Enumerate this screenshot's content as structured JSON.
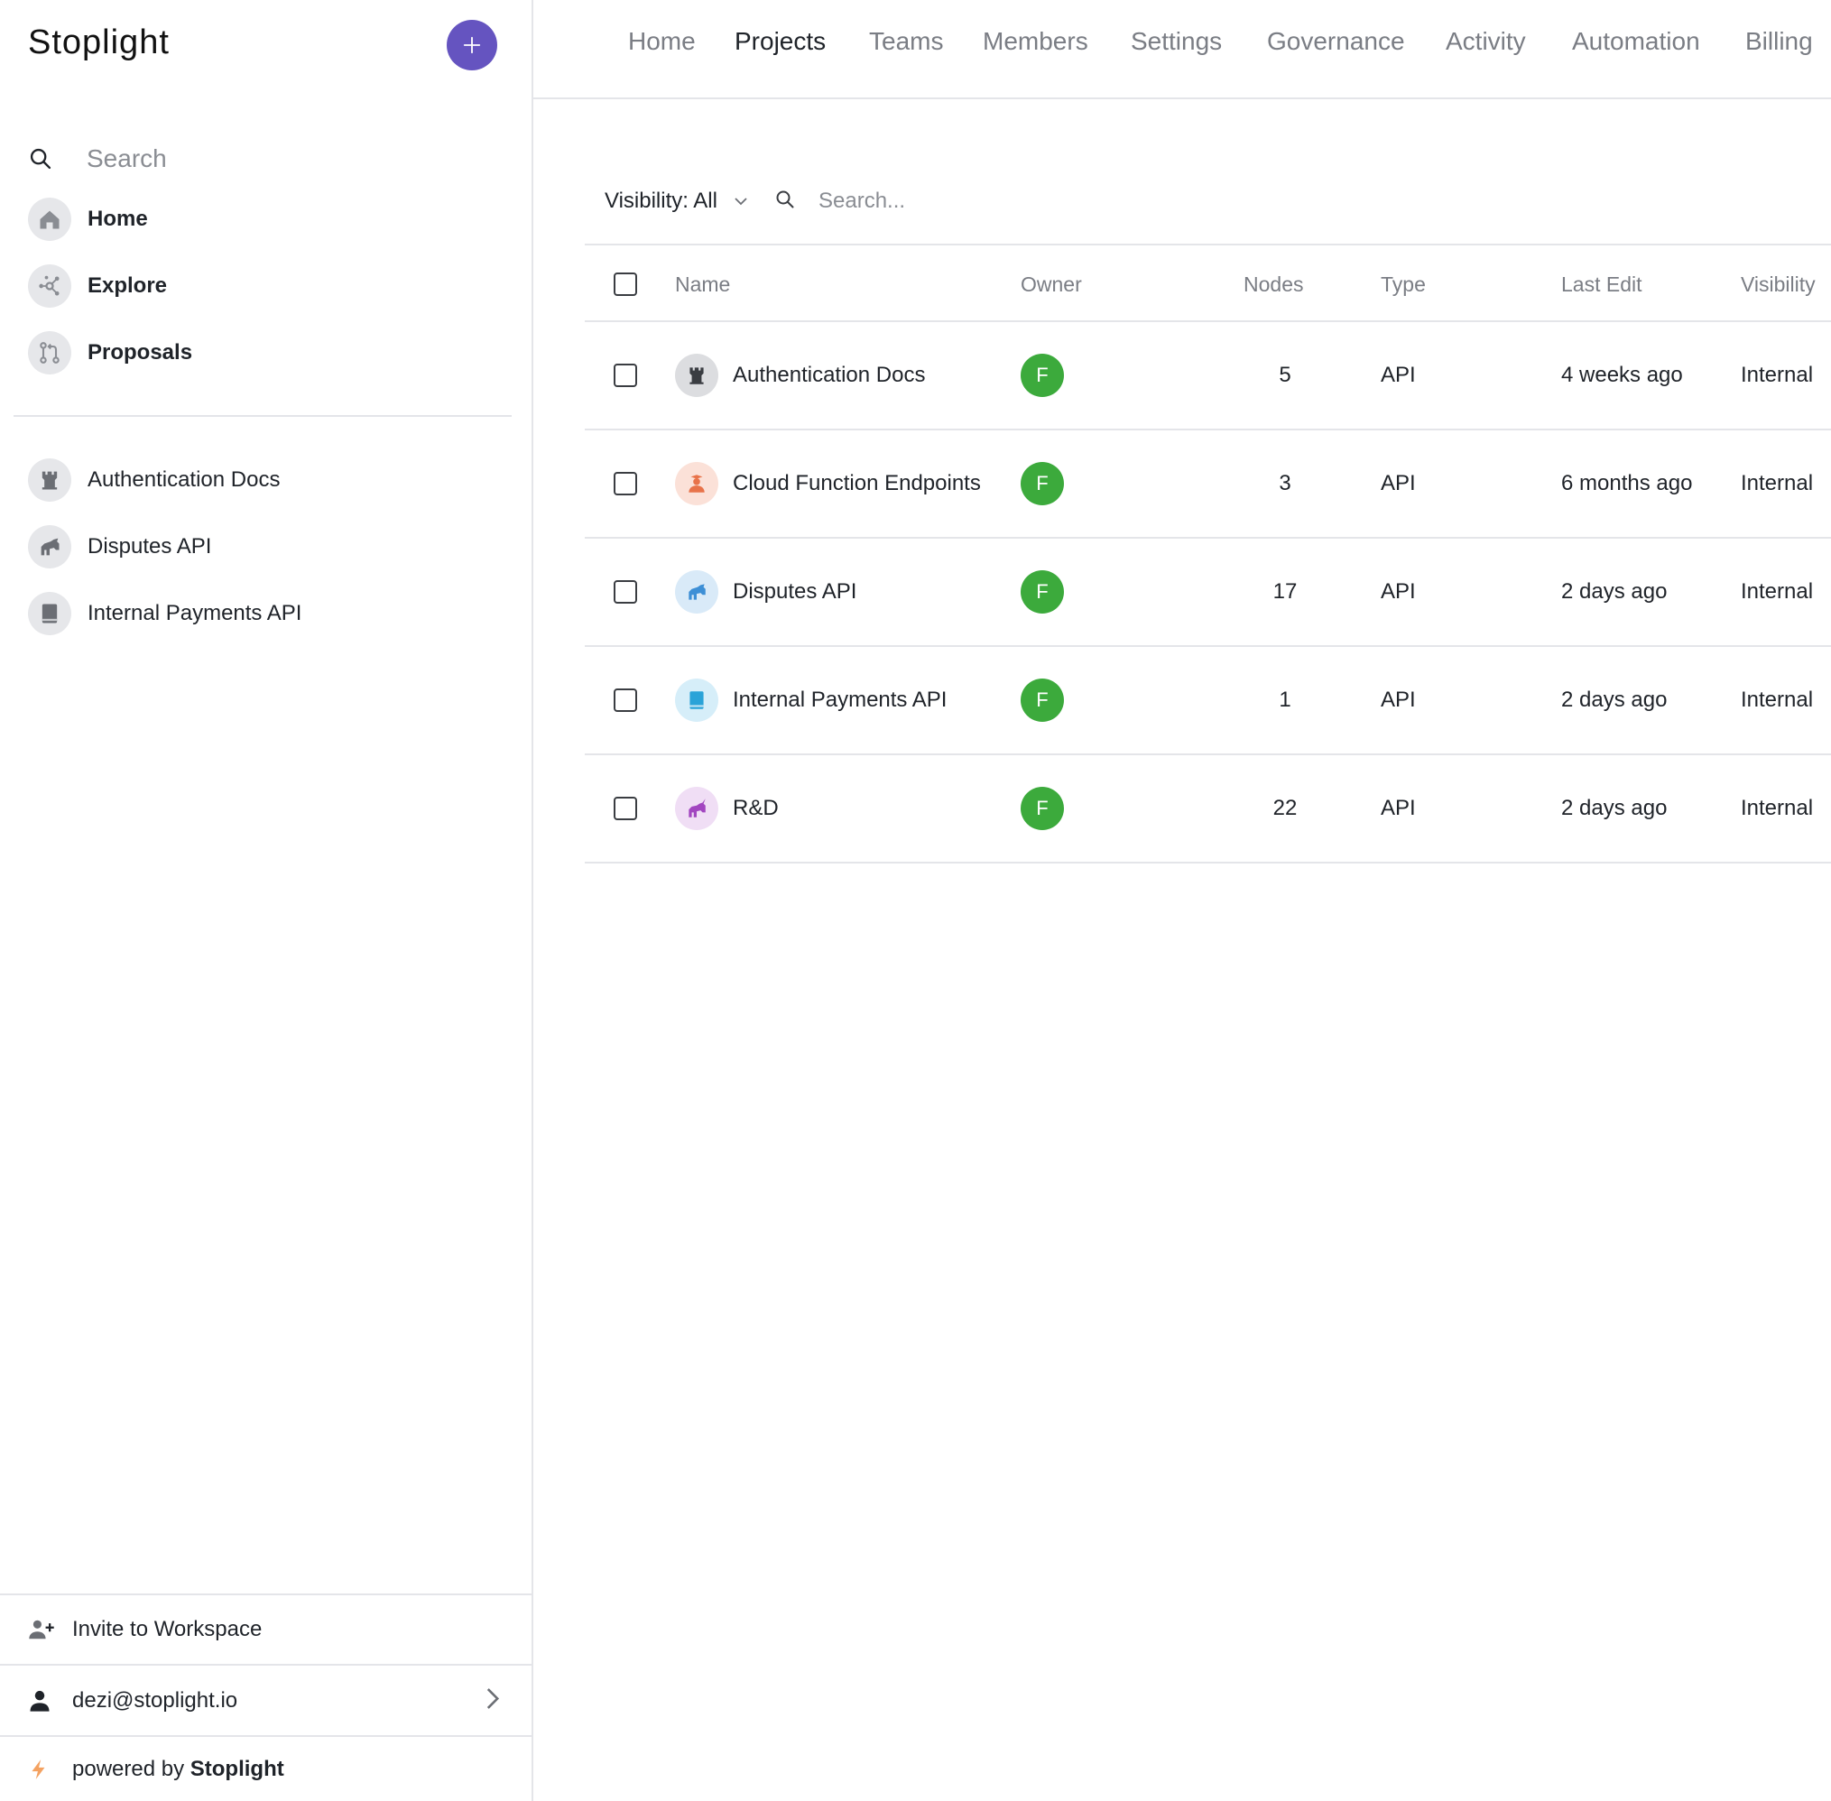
{
  "sidebar": {
    "brand": "Stoplight",
    "search_placeholder": "Search",
    "nav": [
      {
        "label": "Home",
        "icon": "home-icon"
      },
      {
        "label": "Explore",
        "icon": "explore-icon"
      },
      {
        "label": "Proposals",
        "icon": "proposals-icon"
      }
    ],
    "projects": [
      {
        "label": "Authentication Docs",
        "icon": "castle-icon"
      },
      {
        "label": "Disputes API",
        "icon": "horse-icon"
      },
      {
        "label": "Internal Payments API",
        "icon": "book-icon"
      }
    ],
    "invite_label": "Invite to Workspace",
    "user_email": "dezi@stoplight.io",
    "powered_prefix": "powered by",
    "powered_brand": "Stoplight"
  },
  "topnav": {
    "tabs": [
      "Home",
      "Projects",
      "Teams",
      "Members",
      "Settings",
      "Governance",
      "Activity",
      "Automation",
      "Billing"
    ],
    "active": "Projects"
  },
  "filters": {
    "visibility_label": "Visibility: All",
    "search_placeholder": "Search..."
  },
  "table": {
    "headers": {
      "name": "Name",
      "owner": "Owner",
      "nodes": "Nodes",
      "type": "Type",
      "last_edit": "Last Edit",
      "visibility": "Visibility"
    },
    "rows": [
      {
        "name": "Authentication Docs",
        "icon": "castle-icon",
        "icon_color": "#3a3d42",
        "icon_bg": "#dcdde0",
        "owner": "F",
        "nodes": "5",
        "type": "API",
        "last_edit": "4 weeks ago",
        "visibility": "Internal"
      },
      {
        "name": "Cloud Function Endpoints",
        "icon": "person-icon",
        "icon_color": "#e8734a",
        "icon_bg": "#fbe1d8",
        "owner": "F",
        "nodes": "3",
        "type": "API",
        "last_edit": "6 months ago",
        "visibility": "Internal"
      },
      {
        "name": "Disputes API",
        "icon": "horse-icon",
        "icon_color": "#3d8fd6",
        "icon_bg": "#d9eaf8",
        "owner": "F",
        "nodes": "17",
        "type": "API",
        "last_edit": "2 days ago",
        "visibility": "Internal"
      },
      {
        "name": "Internal Payments API",
        "icon": "book-icon",
        "icon_color": "#2aa3d8",
        "icon_bg": "#d6eef9",
        "owner": "F",
        "nodes": "1",
        "type": "API",
        "last_edit": "2 days ago",
        "visibility": "Internal"
      },
      {
        "name": "R&D",
        "icon": "unicorn-icon",
        "icon_color": "#a246c0",
        "icon_bg": "#f0def5",
        "owner": "F",
        "nodes": "22",
        "type": "API",
        "last_edit": "2 days ago",
        "visibility": "Internal"
      }
    ]
  },
  "colors": {
    "accent": "#6554c0",
    "owner_avatar": "#3caa3c",
    "powered_bolt": "#f4a261"
  }
}
